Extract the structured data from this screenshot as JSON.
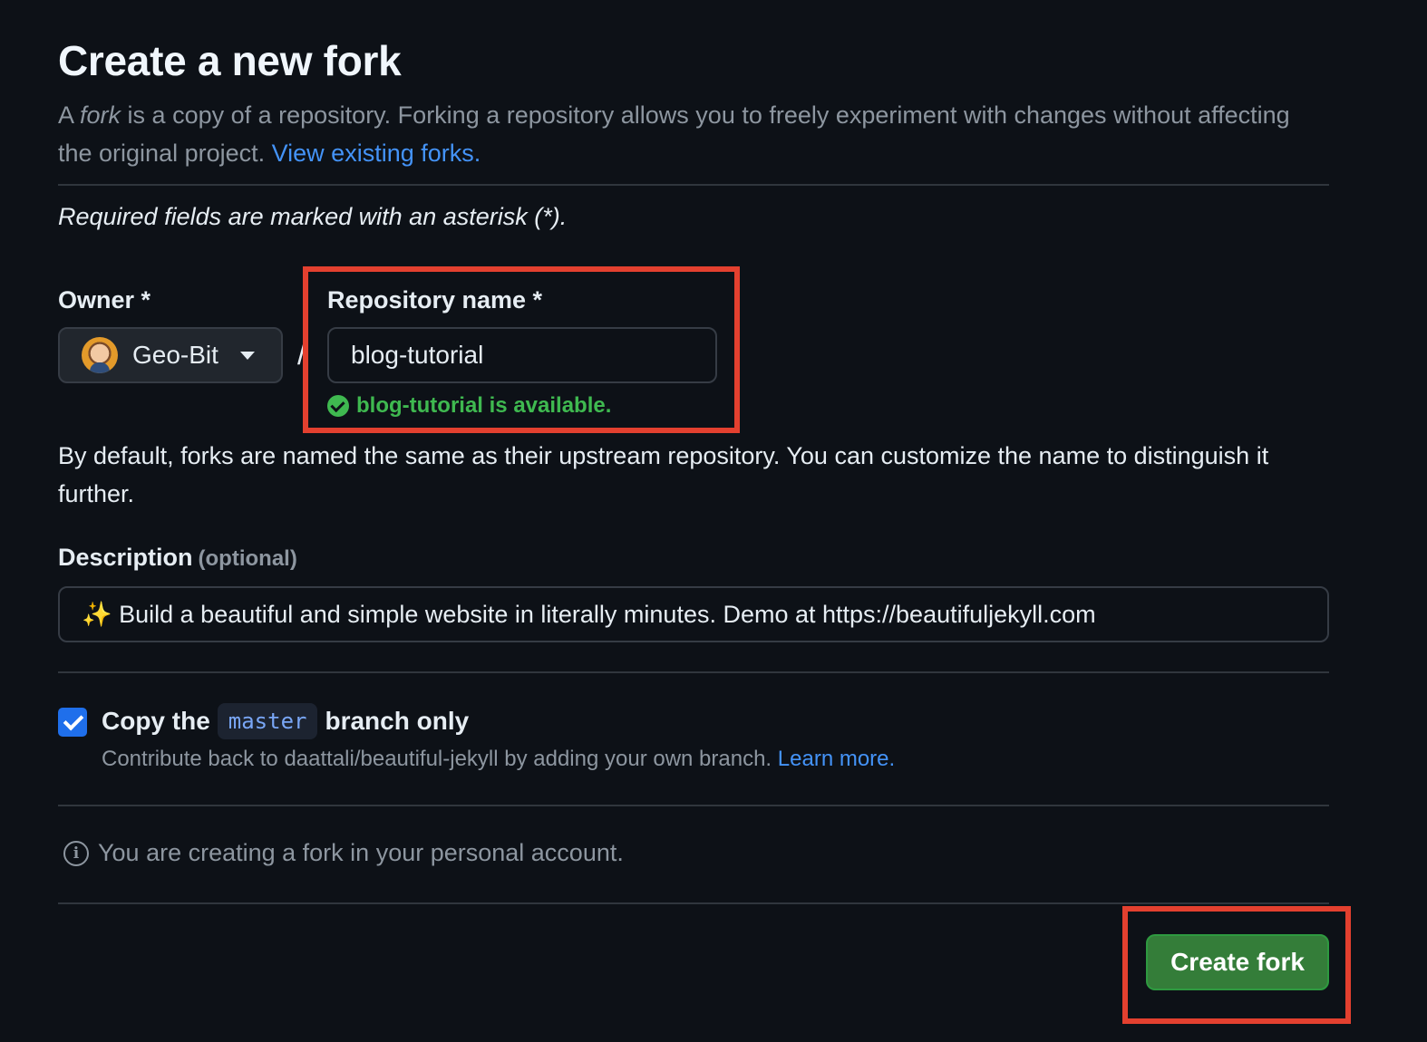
{
  "page": {
    "title": "Create a new fork",
    "intro_a": "A ",
    "intro_fork_word": "fork",
    "intro_b": " is a copy of a repository. Forking a repository allows you to freely experiment with changes without affecting the original project. ",
    "view_forks_link": "View existing forks.",
    "required_note": "Required fields are marked with an asterisk (*)."
  },
  "owner": {
    "label": "Owner *",
    "name": "Geo-Bit"
  },
  "separator": "/",
  "repository": {
    "label": "Repository name *",
    "value": "blog-tutorial",
    "availability": "blog-tutorial is available."
  },
  "help_text": "By default, forks are named the same as their upstream repository. You can customize the name to distinguish it further.",
  "description": {
    "label": "Description",
    "optional": "(optional)",
    "value": "✨ Build a beautiful and simple website in literally minutes. Demo at https://beautifuljekyll.com"
  },
  "copy_branch": {
    "checked": true,
    "label_before": "Copy the",
    "branch": "master",
    "label_after": "branch only",
    "sub_text": "Contribute back to daattali/beautiful-jekyll by adding your own branch. ",
    "learn_more": "Learn more."
  },
  "info": {
    "icon": "info-icon",
    "text": "You are creating a fork in your personal account."
  },
  "actions": {
    "create_label": "Create fork"
  },
  "colors": {
    "background": "#0d1117",
    "accent_link": "#4493f8",
    "success": "#3fb950",
    "primary_button": "#347d39",
    "highlight": "#e3402f"
  }
}
